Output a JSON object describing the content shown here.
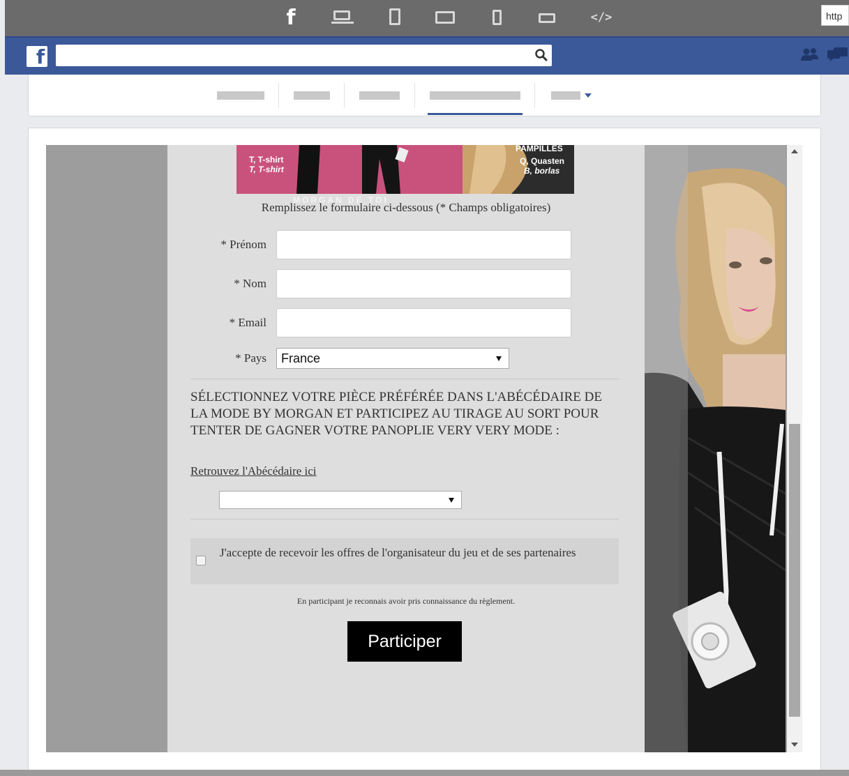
{
  "toolbar": {
    "url_text": "http",
    "icons": [
      "facebook-icon",
      "laptop-icon",
      "tablet-portrait-icon",
      "tablet-landscape-icon",
      "phone-portrait-icon",
      "phone-landscape-icon",
      "code-icon"
    ]
  },
  "facebook": {
    "logo": "f",
    "search_placeholder": ""
  },
  "banner": {
    "left_line1": "T, T-shirt",
    "left_line2": "T, T-shirt",
    "right_title": "PAMPILLES",
    "right_line1": "Q, Quasten",
    "right_line2": "B, borlas",
    "brand": "MORGAN DE TOI"
  },
  "form": {
    "intro": "Remplissez le formulaire ci-dessous (* Champs obligatoires)",
    "prenom_label": "* Prénom",
    "nom_label": "* Nom",
    "email_label": "* Email",
    "pays_label": "* Pays",
    "pays_value": "France",
    "question": "SÉLECTIONNEZ VOTRE PIÈCE PRÉFÉRÉE DANS L'ABÉCÉDAIRE DE LA MODE BY MORGAN ET PARTICIPEZ AU TIRAGE AU SORT POUR TENTER DE GAGNER VOTRE PANOPLIE VERY VERY MODE :",
    "abc_link": "Retrouvez l'Abécédaire ici",
    "piece_value": "",
    "consent": "J'accepte de recevoir les offres de l'organisateur du jeu et de ses partenaires",
    "rules": "En participant je reconnais avoir pris connaissance du règlement.",
    "submit": "Participer"
  },
  "colors": {
    "facebook_blue": "#3b5998",
    "toolbar_gray": "#6b6b6b",
    "banner_pink": "#c9527c",
    "button_black": "#000000"
  }
}
